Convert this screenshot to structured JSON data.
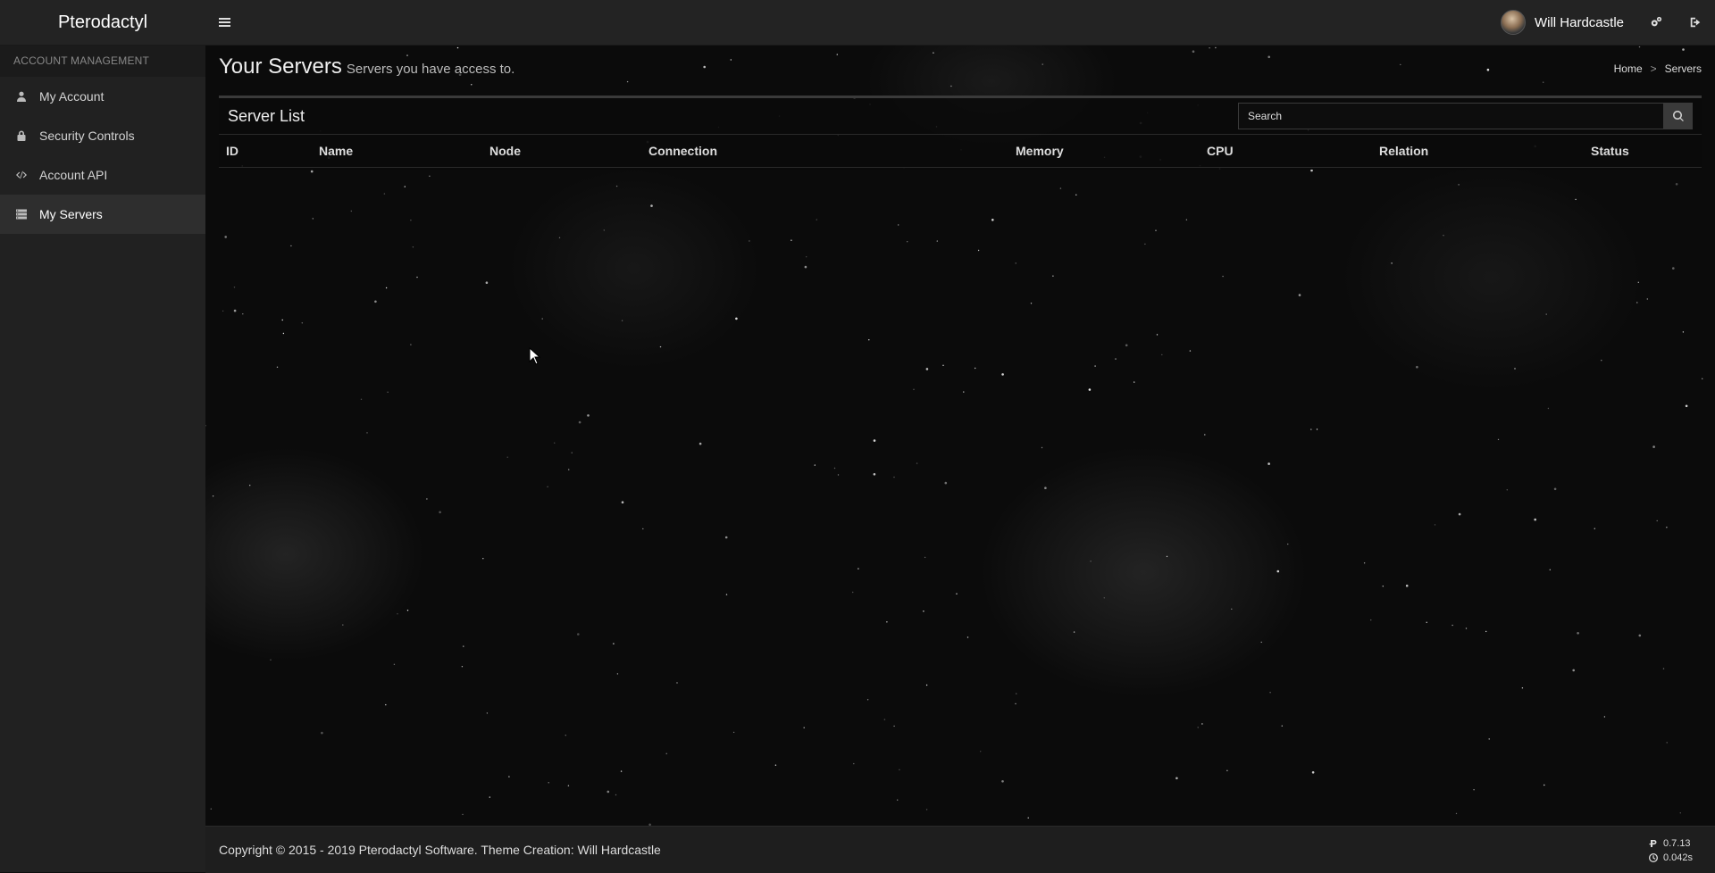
{
  "header": {
    "brand": "Pterodactyl",
    "user_name": "Will Hardcastle"
  },
  "icons": {
    "menu": "bars-icon",
    "settings": "cogs-icon",
    "logout": "sign-out-icon",
    "search": "search-icon"
  },
  "sidebar": {
    "section_title": "ACCOUNT MANAGEMENT",
    "items": [
      {
        "label": "My Account",
        "icon": "user-icon"
      },
      {
        "label": "Security Controls",
        "icon": "lock-icon"
      },
      {
        "label": "Account API",
        "icon": "code-icon"
      },
      {
        "label": "My Servers",
        "icon": "server-icon",
        "active": true
      }
    ]
  },
  "page": {
    "title": "Your Servers",
    "subtitle": "Servers you have access to.",
    "breadcrumb": [
      "Home",
      "Servers"
    ],
    "breadcrumb_separator": ">"
  },
  "server_list": {
    "title": "Server List",
    "search_placeholder": "Search",
    "columns": [
      "ID",
      "Name",
      "Node",
      "Connection",
      "Memory",
      "CPU",
      "Relation",
      "Status"
    ],
    "rows": []
  },
  "footer": {
    "copyright": "Copyright © 2015 - 2019 Pterodactyl Software. Theme Creation: Will Hardcastle",
    "version": "0.7.13",
    "render_time": "0.042s"
  },
  "colors": {
    "header_bg": "#232323",
    "sidebar_bg": "#212121",
    "content_bg": "#0b0b0b",
    "footer_bg": "#1e1e1e"
  }
}
